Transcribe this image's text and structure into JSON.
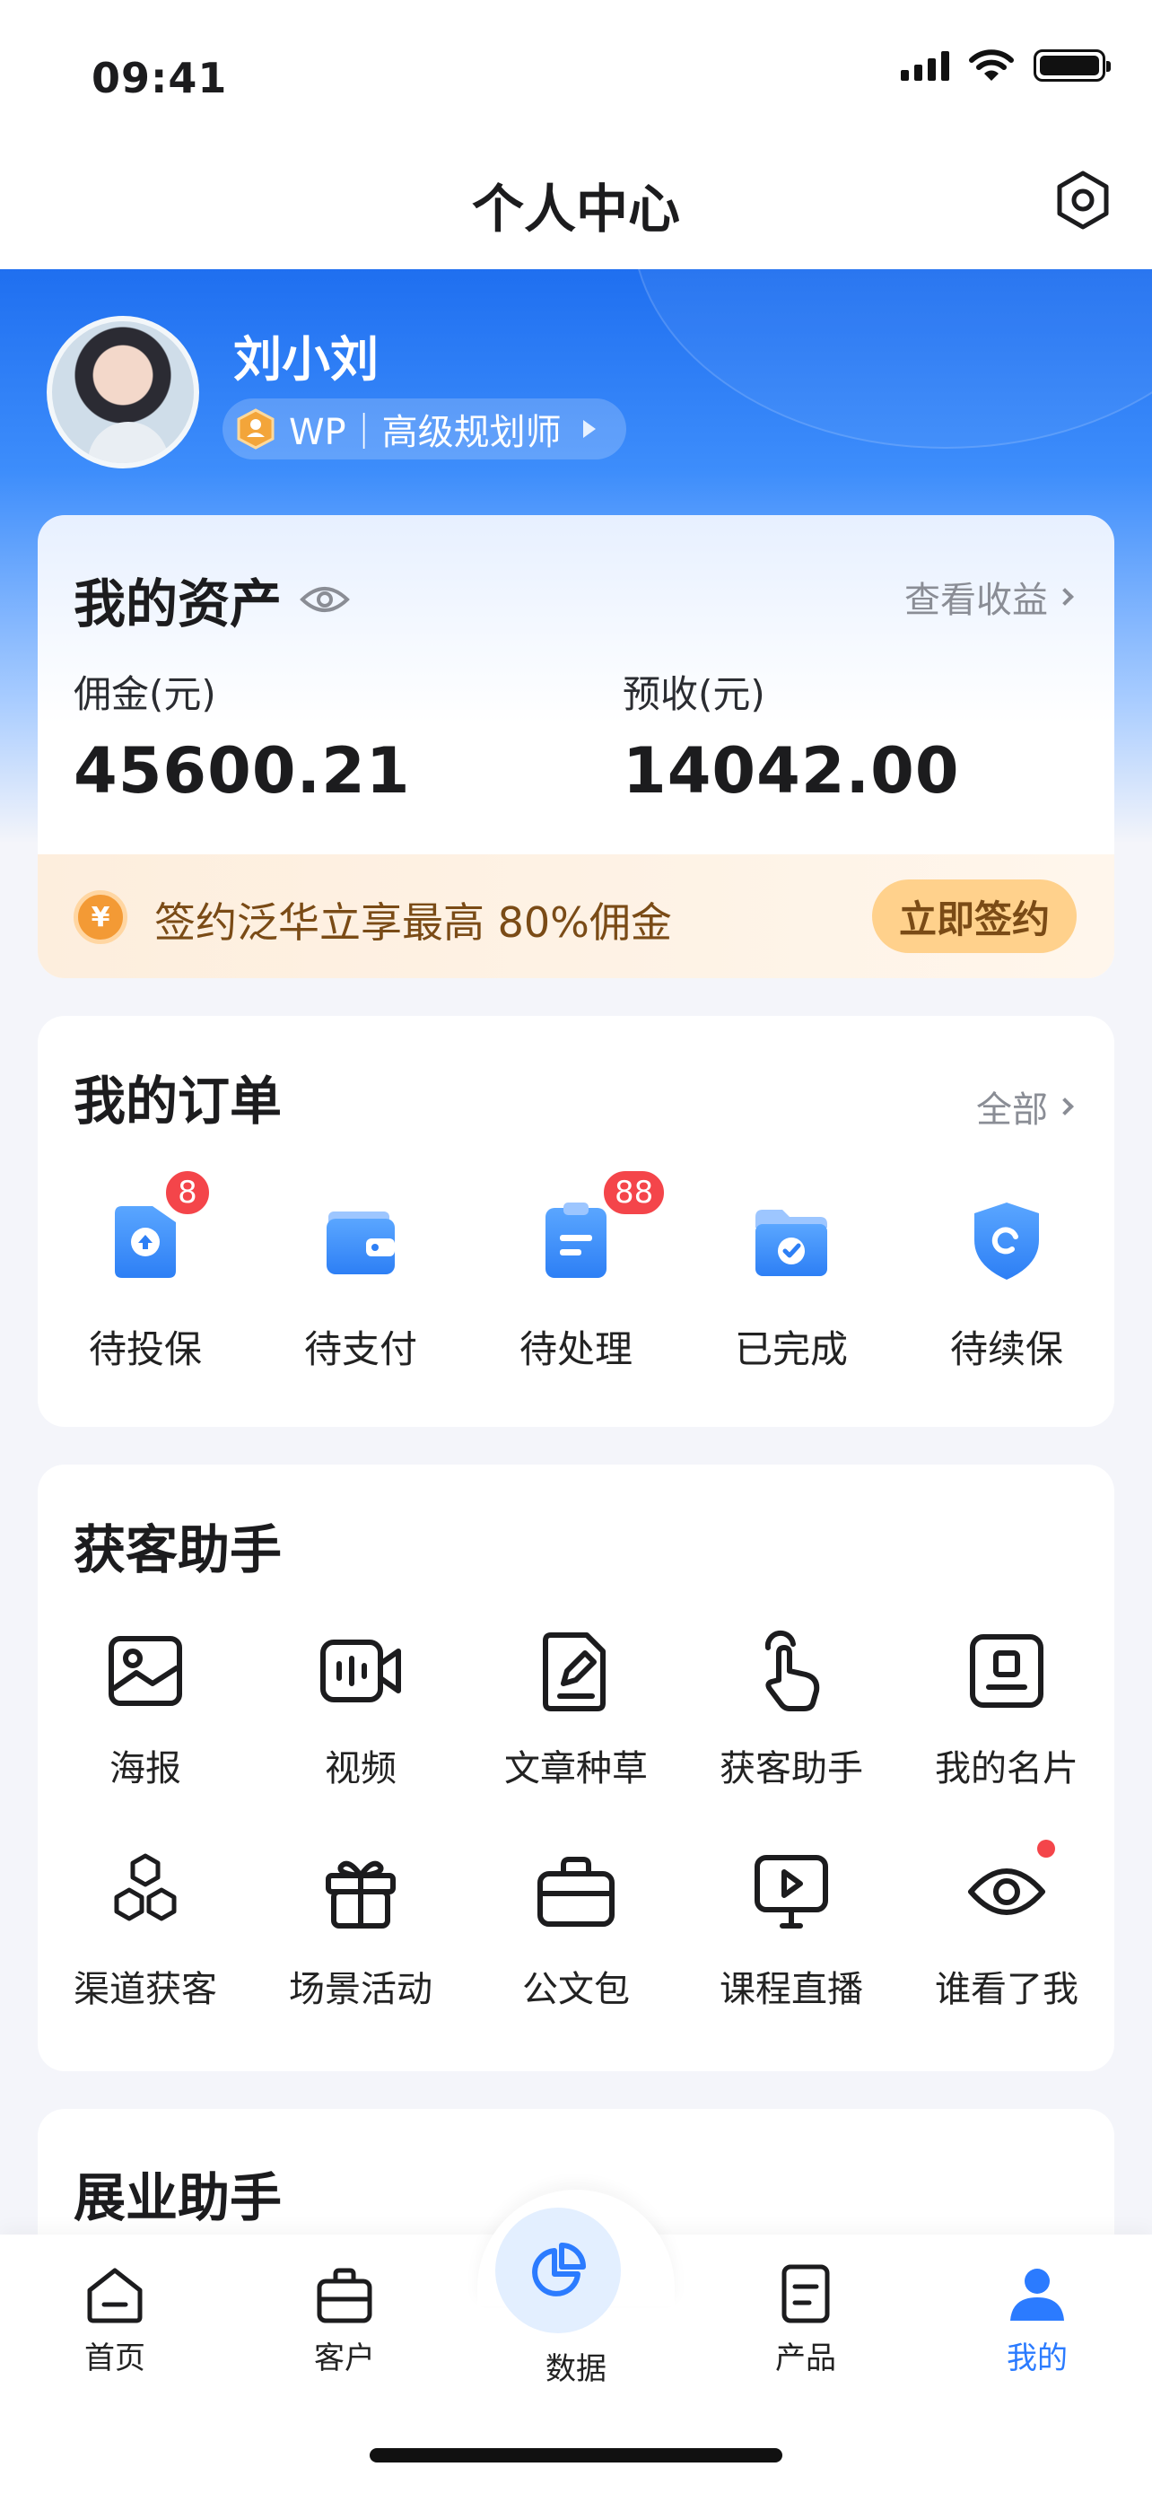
{
  "status_bar": {
    "time": "09:41"
  },
  "nav": {
    "title": "个人中心",
    "settings_icon": "gear-icon"
  },
  "profile": {
    "name": "刘小刘",
    "rank": "WP｜高级规划师"
  },
  "assets": {
    "title": "我的资产",
    "link": "查看收益",
    "commission_label": "佣金(元)",
    "commission_value": "45600.21",
    "expected_label": "预收(元)",
    "expected_value": "14042.00",
    "promo_coin": "¥",
    "promo_text": "签约泛华立享最高 80%佣金",
    "promo_button": "立即签约"
  },
  "orders": {
    "title": "我的订单",
    "link": "全部",
    "items": [
      {
        "label": "待投保",
        "badge": "8",
        "icon": "upload-folder-icon"
      },
      {
        "label": "待支付",
        "badge": "",
        "icon": "wallet-icon"
      },
      {
        "label": "待处理",
        "badge": "88",
        "icon": "clipboard-icon"
      },
      {
        "label": "已完成",
        "badge": "",
        "icon": "check-folder-icon"
      },
      {
        "label": "待续保",
        "badge": "",
        "icon": "shield-refresh-icon"
      }
    ]
  },
  "tools": {
    "title": "获客助手",
    "items": [
      {
        "label": "海报",
        "icon": "image-icon"
      },
      {
        "label": "视频",
        "icon": "video-icon"
      },
      {
        "label": "文章种草",
        "icon": "edit-doc-icon"
      },
      {
        "label": "获客助手",
        "icon": "hand-pointer-icon"
      },
      {
        "label": "我的名片",
        "icon": "id-card-icon"
      },
      {
        "label": "渠道获客",
        "icon": "hexagons-icon"
      },
      {
        "label": "场景活动",
        "icon": "gift-icon"
      },
      {
        "label": "公文包",
        "icon": "briefcase-icon"
      },
      {
        "label": "课程直播",
        "icon": "live-screen-icon"
      },
      {
        "label": "谁看了我",
        "icon": "eye-icon"
      }
    ]
  },
  "biz": {
    "title": "展业助手"
  },
  "tabbar": {
    "items": [
      {
        "label": "首页",
        "icon": "home-icon"
      },
      {
        "label": "客户",
        "icon": "briefcase-icon"
      },
      {
        "label": "数据",
        "icon": "pie-chart-icon"
      },
      {
        "label": "产品",
        "icon": "document-icon"
      },
      {
        "label": "我的",
        "icon": "user-icon"
      }
    ],
    "active": "我的",
    "accent": "#2b7bff"
  }
}
